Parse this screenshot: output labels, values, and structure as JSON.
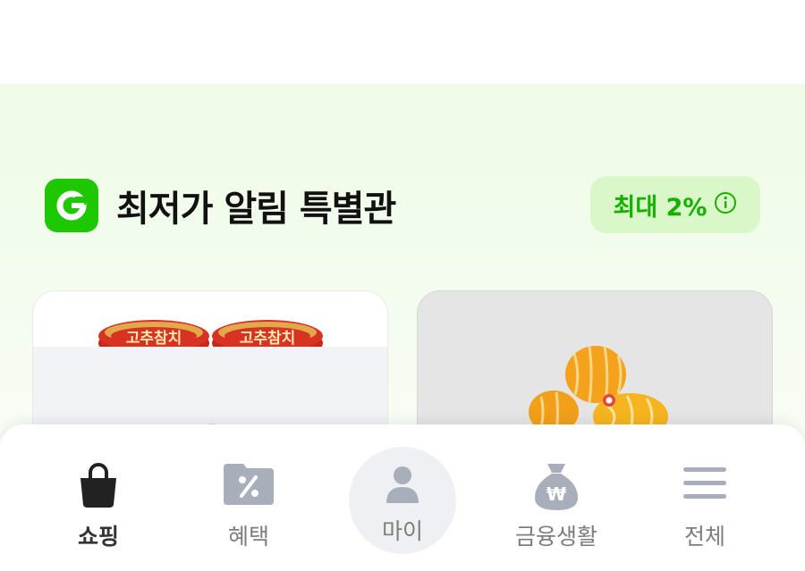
{
  "section": {
    "title": "최저가 알림 특별관",
    "badge_text": "최대 2%",
    "logo_letter": "G",
    "icons": {
      "logo": "g-logo-icon",
      "info": "info-icon"
    }
  },
  "products": [
    {
      "image": "canned-tuna-product-image",
      "package_text": "고추참치"
    },
    {
      "image": "korean-melon-product-image"
    }
  ],
  "tabs": [
    {
      "label": "쇼핑",
      "icon": "shopping-bag-icon",
      "active": true
    },
    {
      "label": "혜택",
      "icon": "percent-folder-icon",
      "active": false
    },
    {
      "label": "마이",
      "icon": "person-icon",
      "active": false
    },
    {
      "label": "금융생활",
      "icon": "money-bag-icon",
      "active": false
    },
    {
      "label": "전체",
      "icon": "menu-icon",
      "active": false
    }
  ],
  "colors": {
    "brand_green": "#1ec800",
    "badge_bg": "#d9f7c8",
    "badge_text": "#17b000",
    "tab_icon": "#a9aebb",
    "tab_active": "#222222"
  }
}
